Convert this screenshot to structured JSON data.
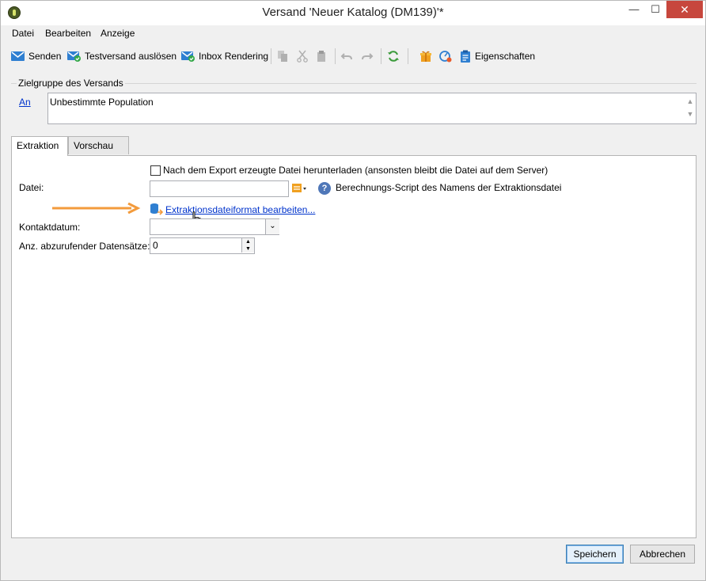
{
  "window": {
    "title": "Versand 'Neuer Katalog (DM139)'*",
    "minimize_label": "—",
    "maximize_label": "☐",
    "close_label": "✕"
  },
  "menu": {
    "items": [
      "Datei",
      "Bearbeiten",
      "Anzeige"
    ]
  },
  "toolbar": {
    "send_label": "Senden",
    "test_label": "Testversand auslösen",
    "inbox_label": "Inbox Rendering",
    "properties_label": "Eigenschaften"
  },
  "audience": {
    "group_label": "Zielgruppe des Versands",
    "to_link": "An",
    "population": "Unbestimmte Population"
  },
  "tabs": {
    "extraction": "Extraktion",
    "preview": "Vorschau"
  },
  "form": {
    "download_checkbox_label": "Nach dem Export erzeugte Datei herunterladen (ansonsten bleibt die Datei auf dem Server)",
    "download_checked": false,
    "file_label": "Datei:",
    "file_value": "",
    "script_label": "Berechnungs-Script des Namens der Extraktionsdatei",
    "format_link": "Extraktionsdateiformat bearbeiten...",
    "contact_date_label": "Kontaktdatum:",
    "contact_date_value": "",
    "records_label": "Anz. abzurufender Datensätze:",
    "records_value": "0"
  },
  "buttons": {
    "save": "Speichern",
    "cancel": "Abbrechen"
  },
  "colors": {
    "accent_orange": "#f39b3c",
    "link": "#0033cc",
    "close_red": "#c7473d"
  }
}
